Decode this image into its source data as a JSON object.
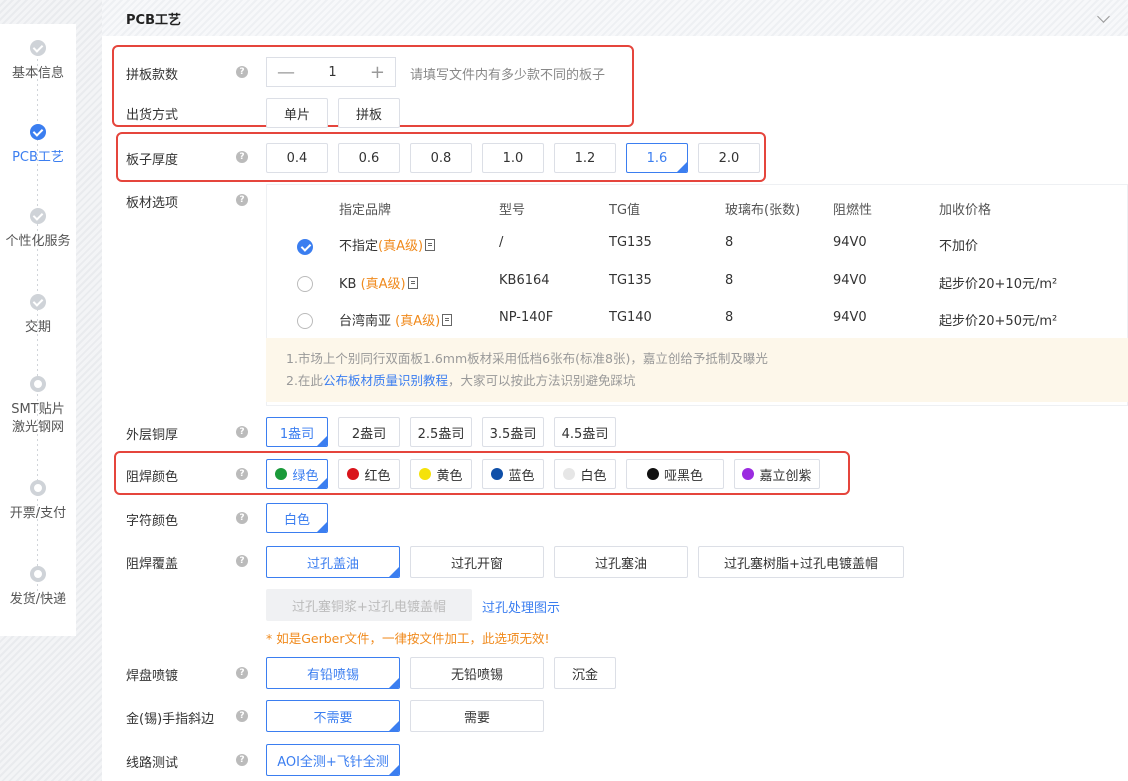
{
  "steps": [
    {
      "label": "基本信息",
      "state": "done"
    },
    {
      "label": "PCB工艺",
      "state": "active"
    },
    {
      "label": "个性化服务",
      "state": "done"
    },
    {
      "label": "交期",
      "state": "done"
    },
    {
      "label_line1": "SMT贴片",
      "label_line2": "激光钢网",
      "state": "todo"
    },
    {
      "label": "开票/支付",
      "state": "todo"
    },
    {
      "label": "发货/快递",
      "state": "todo"
    }
  ],
  "panel": {
    "title": "PCB工艺",
    "help_glyph": "?"
  },
  "panel_count": {
    "label": "拼板款数",
    "value": "1",
    "minus": "—",
    "plus": "+",
    "hint": "请填写文件内有多少款不同的板子"
  },
  "shipping": {
    "label": "出货方式",
    "options": [
      "单片",
      "拼板"
    ]
  },
  "thickness": {
    "label": "板子厚度",
    "options": [
      "0.4",
      "0.6",
      "0.8",
      "1.0",
      "1.2",
      "1.6",
      "2.0"
    ],
    "selected": "1.6"
  },
  "material": {
    "label": "板材选项",
    "headers": [
      "指定品牌",
      "型号",
      "TG值",
      "玻璃布(张数)",
      "阻燃性",
      "加收价格"
    ],
    "rows": [
      {
        "brand": "不指定",
        "grade": "(真A级)",
        "model": "/",
        "tg": "TG135",
        "glass": "8",
        "flame": "94V0",
        "price": "不加价",
        "selected": true
      },
      {
        "brand": "KB",
        "grade": "(真A级)",
        "model": "KB6164",
        "tg": "TG135",
        "glass": "8",
        "flame": "94V0",
        "price": "起步价20+10元/m²",
        "selected": false
      },
      {
        "brand": "台湾南亚",
        "grade": "(真A级)",
        "model": "NP-140F",
        "tg": "TG140",
        "glass": "8",
        "flame": "94V0",
        "price": "起步价20+50元/m²",
        "selected": false
      }
    ],
    "note1": "1.市场上个别同行双面板1.6mm板材采用低档6张布(标准8张)，嘉立创给予抵制及曝光",
    "note2_pre": "2.在此",
    "note2_link": "公布板材质量识别教程",
    "note2_post": "，大家可以按此方法识别避免踩坑"
  },
  "copper": {
    "label": "外层铜厚",
    "options": [
      "1盎司",
      "2盎司",
      "2.5盎司",
      "3.5盎司",
      "4.5盎司"
    ],
    "selected": "1盎司"
  },
  "solder_color": {
    "label": "阻焊颜色",
    "options": [
      {
        "name": "绿色",
        "color": "#1a9a3a"
      },
      {
        "name": "红色",
        "color": "#d9141b"
      },
      {
        "name": "黄色",
        "color": "#f5e20a"
      },
      {
        "name": "蓝色",
        "color": "#0f4fa8"
      },
      {
        "name": "白色",
        "color": "#e6e6e6"
      },
      {
        "name": "哑黑色",
        "color": "#111111"
      },
      {
        "name": "嘉立创紫",
        "color": "#9b2be0"
      }
    ],
    "selected": "绿色"
  },
  "silk_color": {
    "label": "字符颜色",
    "options": [
      "白色"
    ],
    "selected": "白色"
  },
  "solder_cover": {
    "label": "阻焊覆盖",
    "options": [
      "过孔盖油",
      "过孔开窗",
      "过孔塞油",
      "过孔塞树脂+过孔电镀盖帽"
    ],
    "disabled_option": "过孔塞铜浆+过孔电镀盖帽",
    "link": "过孔处理图示",
    "warning": "* 如是Gerber文件，一律按文件加工，此选项无效!",
    "selected": "过孔盖油"
  },
  "surface": {
    "label": "焊盘喷镀",
    "options": [
      "有铅喷锡",
      "无铅喷锡",
      "沉金"
    ],
    "selected": "有铅喷锡"
  },
  "gold_finger": {
    "label": "金(锡)手指斜边",
    "options": [
      "不需要",
      "需要"
    ],
    "selected": "不需要"
  },
  "test": {
    "label": "线路测试",
    "options": [
      "AOI全测+飞针全测"
    ],
    "selected": "AOI全测+飞针全测"
  },
  "colors": {
    "accent": "#3b7ef0",
    "highlight_box": "#e5453c",
    "warning": "#f08a1c"
  }
}
